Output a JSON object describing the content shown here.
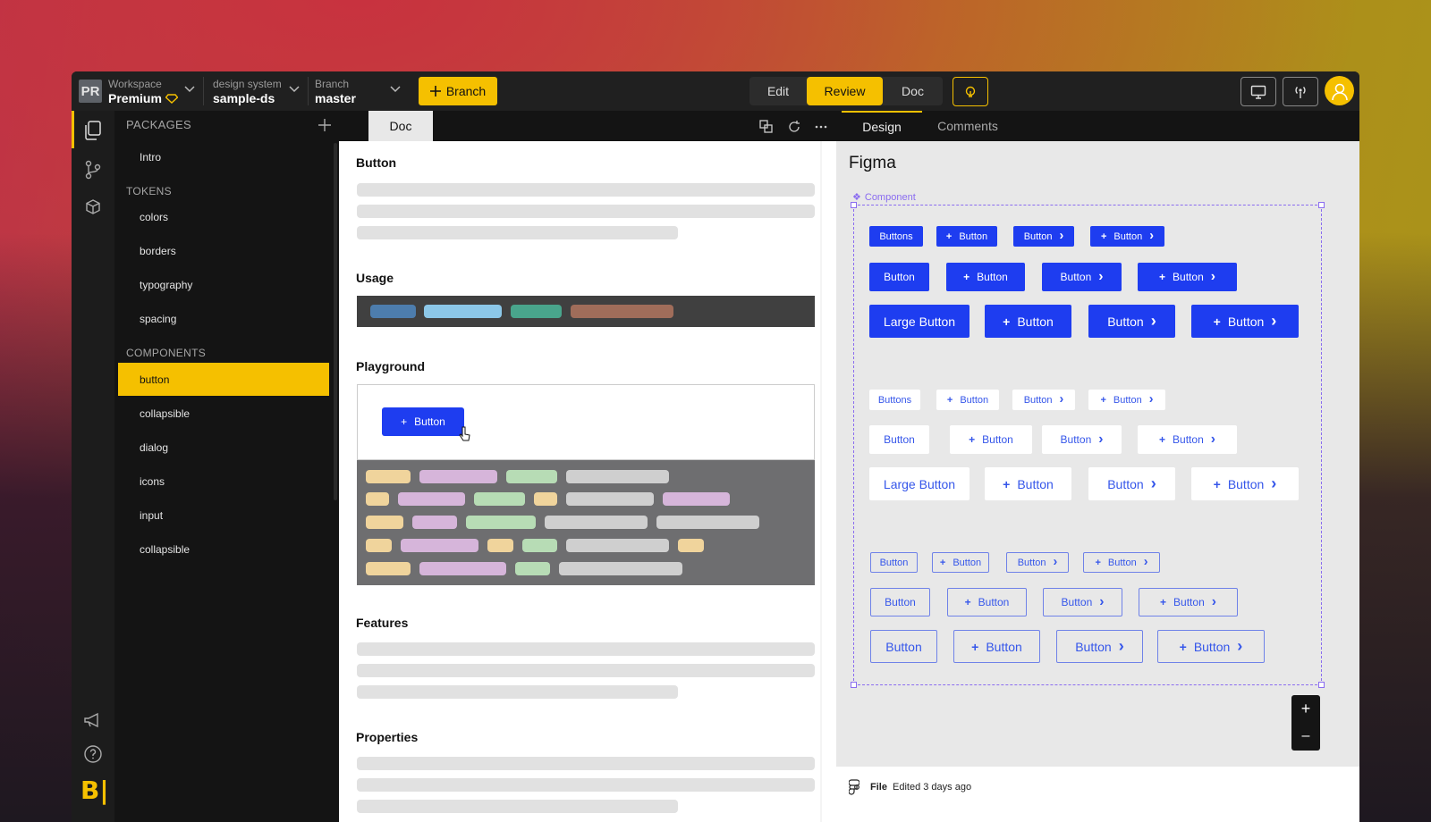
{
  "topbar": {
    "avatar_initials": "PR",
    "workspace": {
      "label": "Workspace",
      "value": "Premium",
      "badge_icon": "gem-icon"
    },
    "design_system": {
      "label": "design system",
      "value": "sample-ds"
    },
    "branch": {
      "label": "Branch",
      "value": "master"
    },
    "branch_button": "Branch",
    "modes": [
      "Edit",
      "Review",
      "Doc"
    ],
    "active_mode": "Review",
    "accent": "#f5c000"
  },
  "rail": {
    "icons": [
      "pages-icon",
      "branch-icon",
      "package-icon",
      "megaphone-icon",
      "help-icon"
    ],
    "logo": "B|"
  },
  "sidebar": {
    "packages_label": "PACKAGES",
    "groups": [
      {
        "items": [
          "Intro"
        ]
      },
      {
        "heading": "TOKENS",
        "items": [
          "colors",
          "borders",
          "typography",
          "spacing"
        ]
      },
      {
        "heading": "COMPONENTS",
        "items": [
          "button",
          "collapsible",
          "dialog",
          "icons",
          "input",
          "collapsible"
        ]
      }
    ],
    "selected": "button"
  },
  "tabs": {
    "doc": "Doc",
    "design": "Design",
    "comments": "Comments"
  },
  "doc": {
    "title": "Button",
    "usage": "Usage",
    "playground": "Playground",
    "playground_button": "Button",
    "features": "Features",
    "properties": "Properties"
  },
  "figma": {
    "title": "Figma",
    "component_label": "Component",
    "rows": [
      [
        "Buttons",
        "Button",
        "Button",
        "Button"
      ],
      [
        "Button",
        "Button",
        "Button",
        "Button"
      ],
      [
        "Large Button",
        "Button",
        "Button",
        "Button"
      ],
      [
        "Buttons",
        "Button",
        "Button",
        "Button"
      ],
      [
        "Button",
        "Button",
        "Button",
        "Button"
      ],
      [
        "Large Button",
        "Button",
        "Button",
        "Button"
      ],
      [
        "Button",
        "Button",
        "Button",
        "Button"
      ],
      [
        "Button",
        "Button",
        "Button",
        "Button"
      ],
      [
        "Button",
        "Button",
        "Button",
        "Button"
      ]
    ],
    "zoom_in": "+",
    "zoom_out": "–",
    "file_label": "File",
    "edited": "Edited 3 days ago"
  },
  "colors": {
    "primary_blue": "#1e3df0",
    "accent_yellow": "#f5c000"
  }
}
